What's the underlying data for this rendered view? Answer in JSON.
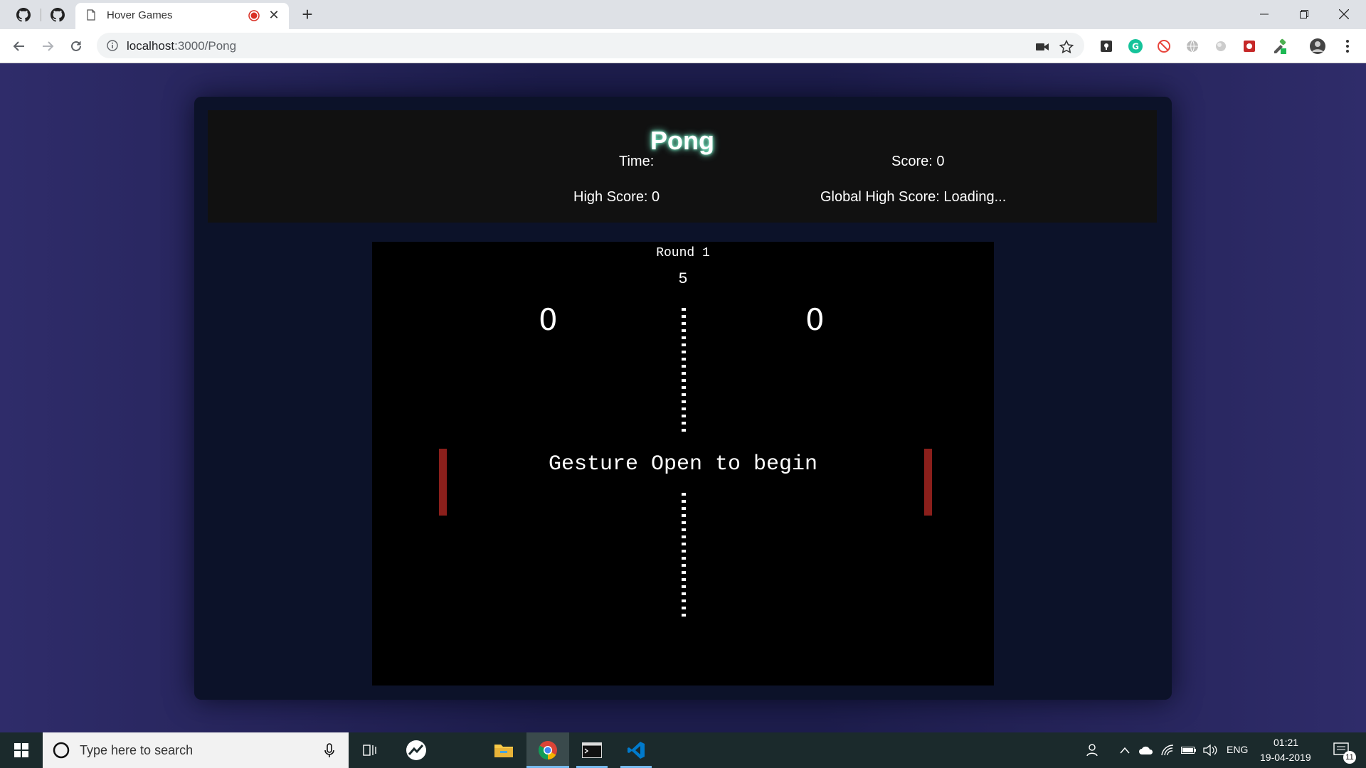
{
  "browser": {
    "tab_title": "Hover Games",
    "url_host": "localhost",
    "url_path": ":3000/Pong",
    "close_glyph": "✕",
    "newtab_glyph": "+",
    "pinned_tabs": [
      "github-icon",
      "github-icon"
    ],
    "window_controls": [
      "minimize",
      "restore",
      "close"
    ]
  },
  "header": {
    "title": "Pong",
    "time_label": "Time:",
    "score_label": "Score: 0",
    "high_score_label": "High Score: 0",
    "global_high_score_label": "Global High Score: Loading..."
  },
  "game": {
    "round_label": "Round 1",
    "countdown": "5",
    "left_score": "0",
    "right_score": "0",
    "message": "Gesture Open to begin",
    "paddle_color": "#8b1f1b"
  },
  "taskbar": {
    "search_placeholder": "Type here to search",
    "language": "ENG",
    "time": "01:21",
    "date": "19-04-2019",
    "notification_count": "11"
  },
  "colors": {
    "accent_glow": "#7fffd4",
    "page_bg": "#2c2a66",
    "card_bg": "#0c1229"
  }
}
